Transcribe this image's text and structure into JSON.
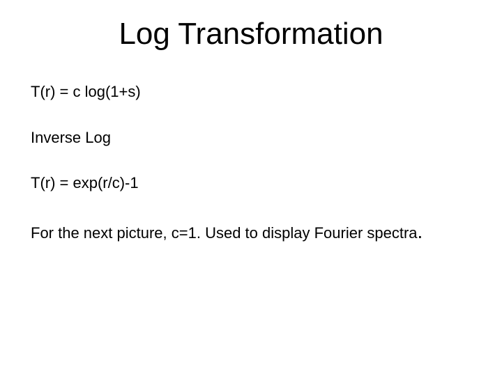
{
  "title": "Log Transformation",
  "lines": {
    "eq1": "T(r) = c log(1+s)",
    "label": "Inverse Log",
    "eq2": "T(r) = exp(r/c)-1",
    "note_main": "For the next picture, c=1. Used to display Fourier spectra",
    "note_trail": "."
  }
}
